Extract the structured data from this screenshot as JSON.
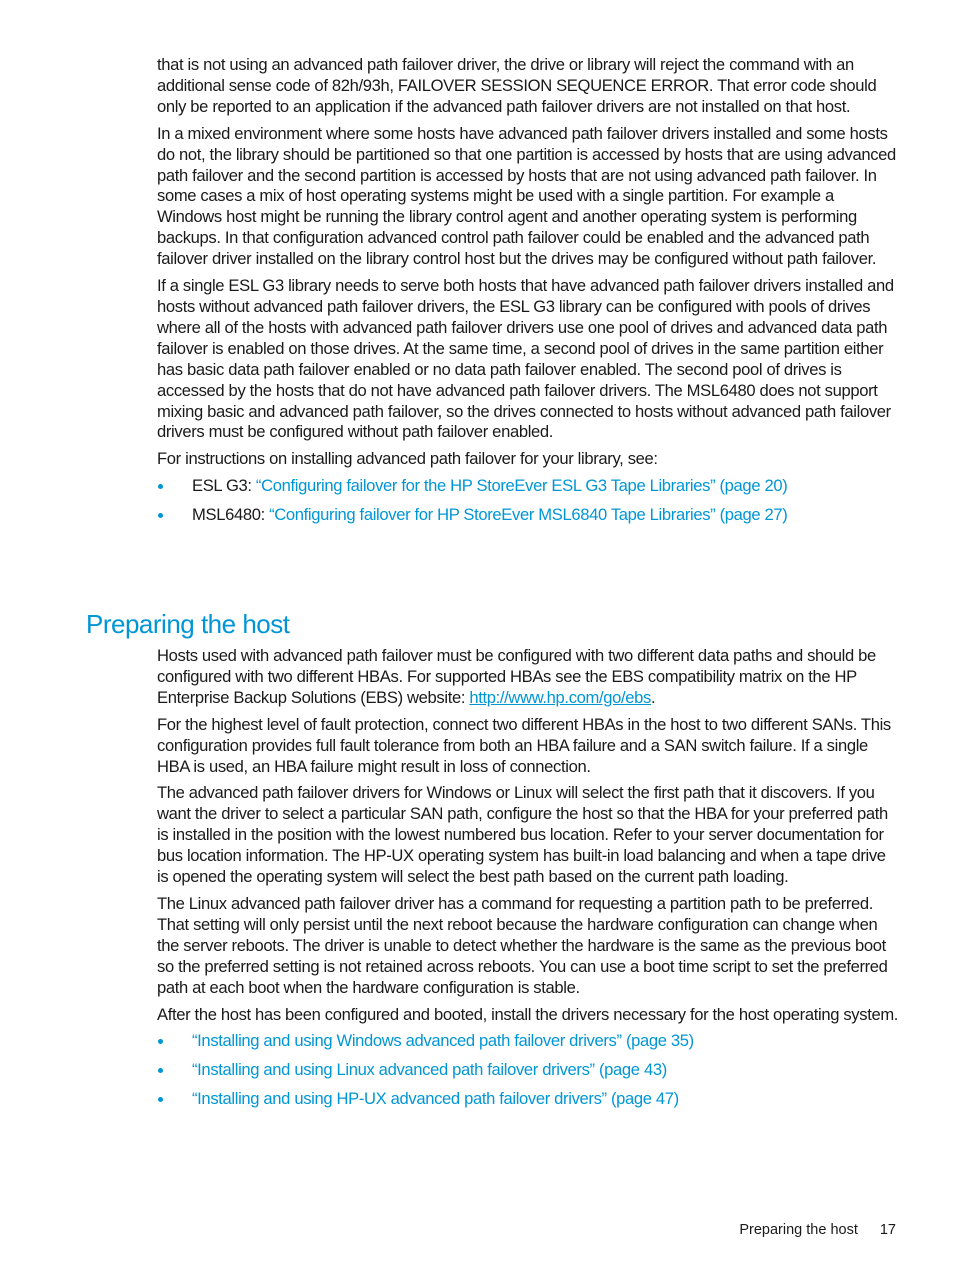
{
  "intro_paragraphs": [
    "that is not using an advanced path failover driver, the drive or library will reject the command with an additional sense code of 82h/93h, FAILOVER SESSION SEQUENCE ERROR. That error code should only be reported to an application if the advanced path failover drivers are not installed on that host.",
    "In a mixed environment where some hosts have advanced path failover drivers installed and some hosts do not, the library should be partitioned so that one partition is accessed by hosts that are using advanced path failover and the second partition is accessed by hosts that are not using advanced path failover. In some cases a mix of host operating systems might be used with a single partition. For example a Windows host might be running the library control agent and another operating system is performing backups. In that configuration advanced control path failover could be enabled and the advanced path failover driver installed on the library control host but the drives may be configured without path failover.",
    "If a single ESL G3 library needs to serve both hosts that have advanced path failover drivers installed and hosts without advanced path failover drivers, the ESL G3 library can be configured with pools of drives where all of the hosts with advanced path failover drivers use one pool of drives and advanced data path failover is enabled on those drives. At the same time, a second pool of drives in the same partition either has basic data path failover enabled or no data path failover enabled. The second pool of drives is accessed by the hosts that do not have advanced path failover drivers. The MSL6480 does not support mixing basic and advanced path failover, so the drives connected to hosts without advanced path failover drivers must be configured without path failover enabled.",
    "For instructions on installing advanced path failover for your library, see:"
  ],
  "library_links": [
    {
      "prefix": "ESL G3: ",
      "link": "“Configuring failover for the HP StoreEver ESL G3 Tape Libraries” (page 20)"
    },
    {
      "prefix": "MSL6480: ",
      "link": "“Configuring failover for HP StoreEver MSL6840 Tape Libraries” (page 27)"
    }
  ],
  "section": {
    "heading": "Preparing the host",
    "p1_before": "Hosts used with advanced path failover must be configured with two different data paths and should be configured with two different HBAs. For supported HBAs see the EBS compatibility matrix on the HP Enterprise Backup Solutions (EBS) website: ",
    "p1_url": "http://www.hp.com/go/ebs",
    "p1_after": ".",
    "paragraphs": [
      "For the highest level of fault protection, connect two different HBAs in the host to two different SANs. This configuration provides full fault tolerance from both an HBA failure and a SAN switch failure. If a single HBA is used, an HBA failure might result in loss of connection.",
      "The advanced path failover drivers for Windows or Linux will select the first path that it discovers. If you want the driver to select a particular SAN path, configure the host so that the HBA for your preferred path is installed in the position with the lowest numbered bus location. Refer to your server documentation for bus location information. The HP-UX operating system has built-in load balancing and when a tape drive is opened the operating system will select the best path based on the current path loading.",
      "The Linux advanced path failover driver has a command for requesting a partition path to be preferred. That setting will only persist until the next reboot because the hardware configuration can change when the server reboots. The driver is unable to detect whether the hardware is the same as the previous boot so the preferred setting is not retained across reboots. You can use a boot time script to set the preferred path at each boot when the hardware configuration is stable.",
      "After the host has been configured and booted, install the drivers necessary for the host operating system."
    ],
    "driver_links": [
      "“Installing and using Windows advanced path failover drivers” (page 35)",
      "“Installing and using Linux advanced path failover drivers” (page 43)",
      "“Installing and using HP-UX advanced path failover drivers” (page 47)"
    ]
  },
  "footer": {
    "running_title": "Preparing the host",
    "page_number": "17"
  },
  "colors": {
    "link": "#0096d6",
    "heading": "#0096d6",
    "text": "#1a1a1a"
  }
}
